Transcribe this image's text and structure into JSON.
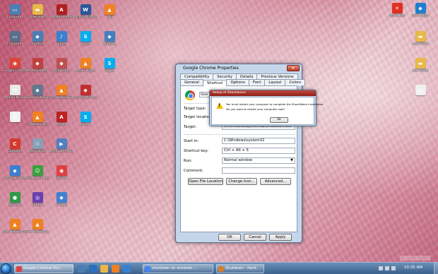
{
  "desktop": {
    "icons": [
      {
        "label": "Computer",
        "icon": "computer-icon",
        "color": "#4a7fb5",
        "glyph": "▭"
      },
      {
        "label": "Computer",
        "icon": "computer-icon",
        "color": "#5a6f8c",
        "glyph": "▭"
      },
      {
        "label": "Google Chrome",
        "icon": "chrome-icon",
        "color": "#db4437",
        "glyph": "◉"
      },
      {
        "label": "Mobile Movie",
        "icon": "document-icon",
        "color": "#e8e8e8",
        "glyph": "▤"
      },
      {
        "label": "",
        "icon": "document-icon",
        "color": "#f0f0f0",
        "glyph": "▤"
      },
      {
        "label": "CCleaner",
        "icon": "ccleaner-icon",
        "color": "#d33a2c",
        "glyph": "C"
      },
      {
        "label": "Windows Live",
        "icon": "app-icon",
        "color": "#3a7fd0",
        "glyph": "◆"
      },
      {
        "label": "Recorder",
        "icon": "app-icon",
        "color": "#2f9a4a",
        "glyph": "●"
      },
      {
        "label": "The Walking Dead",
        "icon": "vlc-icon",
        "color": "#f08020",
        "glyph": "▲"
      },
      {
        "label": "Downloads",
        "icon": "folder-icon",
        "color": "#e8b84a",
        "glyph": "▬"
      },
      {
        "label": "Shortcut",
        "icon": "app-icon",
        "color": "#4a7fb5",
        "glyph": "◆"
      },
      {
        "label": "Photo Gallery",
        "icon": "app-icon",
        "color": "#c04040",
        "glyph": "◆"
      },
      {
        "label": "Screen Capture",
        "icon": "app-icon",
        "color": "#607890",
        "glyph": "◆"
      },
      {
        "label": "The Walking Dead",
        "icon": "vlc-icon",
        "color": "#f08020",
        "glyph": "▲"
      },
      {
        "label": "Recycle Bin",
        "icon": "recycle-bin-icon",
        "color": "#8aa0b8",
        "glyph": "♲"
      },
      {
        "label": "Windows Messenger",
        "icon": "messenger-icon",
        "color": "#3aa040",
        "glyph": "☺"
      },
      {
        "label": "Firefox",
        "icon": "app-icon",
        "color": "#6a3fb0",
        "glyph": "◎"
      },
      {
        "label": "The Walking Dead",
        "icon": "vlc-icon",
        "color": "#f08020",
        "glyph": "▲"
      },
      {
        "label": "Adobe Reader",
        "icon": "app-icon",
        "color": "#b02020",
        "glyph": "A"
      },
      {
        "label": "iTunes",
        "icon": "app-icon",
        "color": "#3a80d0",
        "glyph": "♪"
      },
      {
        "label": "Recognition",
        "icon": "app-icon",
        "color": "#c05050",
        "glyph": "◆"
      },
      {
        "label": "The Walking Dead",
        "icon": "vlc-icon",
        "color": "#f08020",
        "glyph": "▲"
      },
      {
        "label": "Adobe",
        "icon": "app-icon",
        "color": "#c02020",
        "glyph": "A"
      },
      {
        "label": "Windows Movie Maker",
        "icon": "app-icon",
        "color": "#5080c0",
        "glyph": "▶"
      },
      {
        "label": "Chrome",
        "icon": "app-icon",
        "color": "#e04040",
        "glyph": "◉"
      },
      {
        "label": "Google",
        "icon": "app-icon",
        "color": "#4080d0",
        "glyph": "◆"
      },
      {
        "label": "Microsoft Word",
        "icon": "word-icon",
        "color": "#2b579a",
        "glyph": "W"
      },
      {
        "label": "Skype",
        "icon": "skype-icon",
        "color": "#00aff0",
        "glyph": "S"
      },
      {
        "label": "Media Player",
        "icon": "app-icon",
        "color": "#f08020",
        "glyph": "▲"
      },
      {
        "label": "Microsoft Office",
        "icon": "app-icon",
        "color": "#c03030",
        "glyph": "◆"
      },
      {
        "label": "Skype",
        "icon": "skype-icon",
        "color": "#00aff0",
        "glyph": "S"
      },
      {
        "label": "VLC",
        "icon": "vlc-icon",
        "color": "#f08020",
        "glyph": "▲"
      },
      {
        "label": "Windows",
        "icon": "app-icon",
        "color": "#4080c0",
        "glyph": "◆"
      },
      {
        "label": "Skype",
        "icon": "skype-icon",
        "color": "#00aff0",
        "glyph": "S"
      }
    ],
    "right_icons": [
      {
        "label": "Pirate Bay",
        "icon": "x-icon",
        "color": "#e03020",
        "glyph": "✕"
      },
      {
        "label": "Sony Vegas",
        "icon": "app-icon",
        "color": "#2080d0",
        "glyph": "◆"
      },
      {
        "label": "New folder",
        "icon": "folder-icon",
        "color": "#e8b84a",
        "glyph": "▬"
      },
      {
        "label": "New folder",
        "icon": "folder-icon",
        "color": "#e8b84a",
        "glyph": "▬"
      },
      {
        "label": "",
        "icon": "document-icon",
        "color": "#f0f0f0",
        "glyph": "▤"
      }
    ]
  },
  "properties_window": {
    "title": "Google Chrome Properties",
    "close_glyph": "✕",
    "tabs_top": [
      "Compatibility",
      "Security",
      "Details",
      "Previous Versions"
    ],
    "tabs_bottom": [
      "General",
      "Shortcut",
      "Options",
      "Font",
      "Layout",
      "Colors"
    ],
    "active_tab": "Shortcut",
    "name_value": "Goo",
    "rows": {
      "target_type_label": "Target type:",
      "target_location_label": "Target location:",
      "target_label": "Target:",
      "target_value": "C:\\Windows\\System32\\shutdown.exe",
      "start_in_label": "Start in:",
      "start_in_value": "C:\\Windows\\system32",
      "shortcut_key_label": "Shortcut key:",
      "shortcut_key_value": "Ctrl + Alt + S",
      "run_label": "Run:",
      "run_value": "Normal window",
      "comment_label": "Comment:"
    },
    "buttons": {
      "open_location": "Open File Location",
      "change_icon": "Change Icon...",
      "advanced": "Advanced...",
      "ok": "OK",
      "cancel": "Cancel",
      "apply": "Apply"
    }
  },
  "dialog": {
    "title": "Setup of Shockwave",
    "message_1": "You must restart your computer to complete the ShockWave installation.",
    "message_2": "Do you want to restart your computer now?",
    "ok_label": "ok"
  },
  "taskbar": {
    "tasks": [
      {
        "label": "Google Chrome Pro...",
        "color": "#e04040"
      },
      {
        "label": "shutdown on windows -...",
        "color": "#4285f4"
      },
      {
        "label": "Shutdown - Paint",
        "color": "#d08030"
      }
    ],
    "clock": "10:35 AM"
  }
}
